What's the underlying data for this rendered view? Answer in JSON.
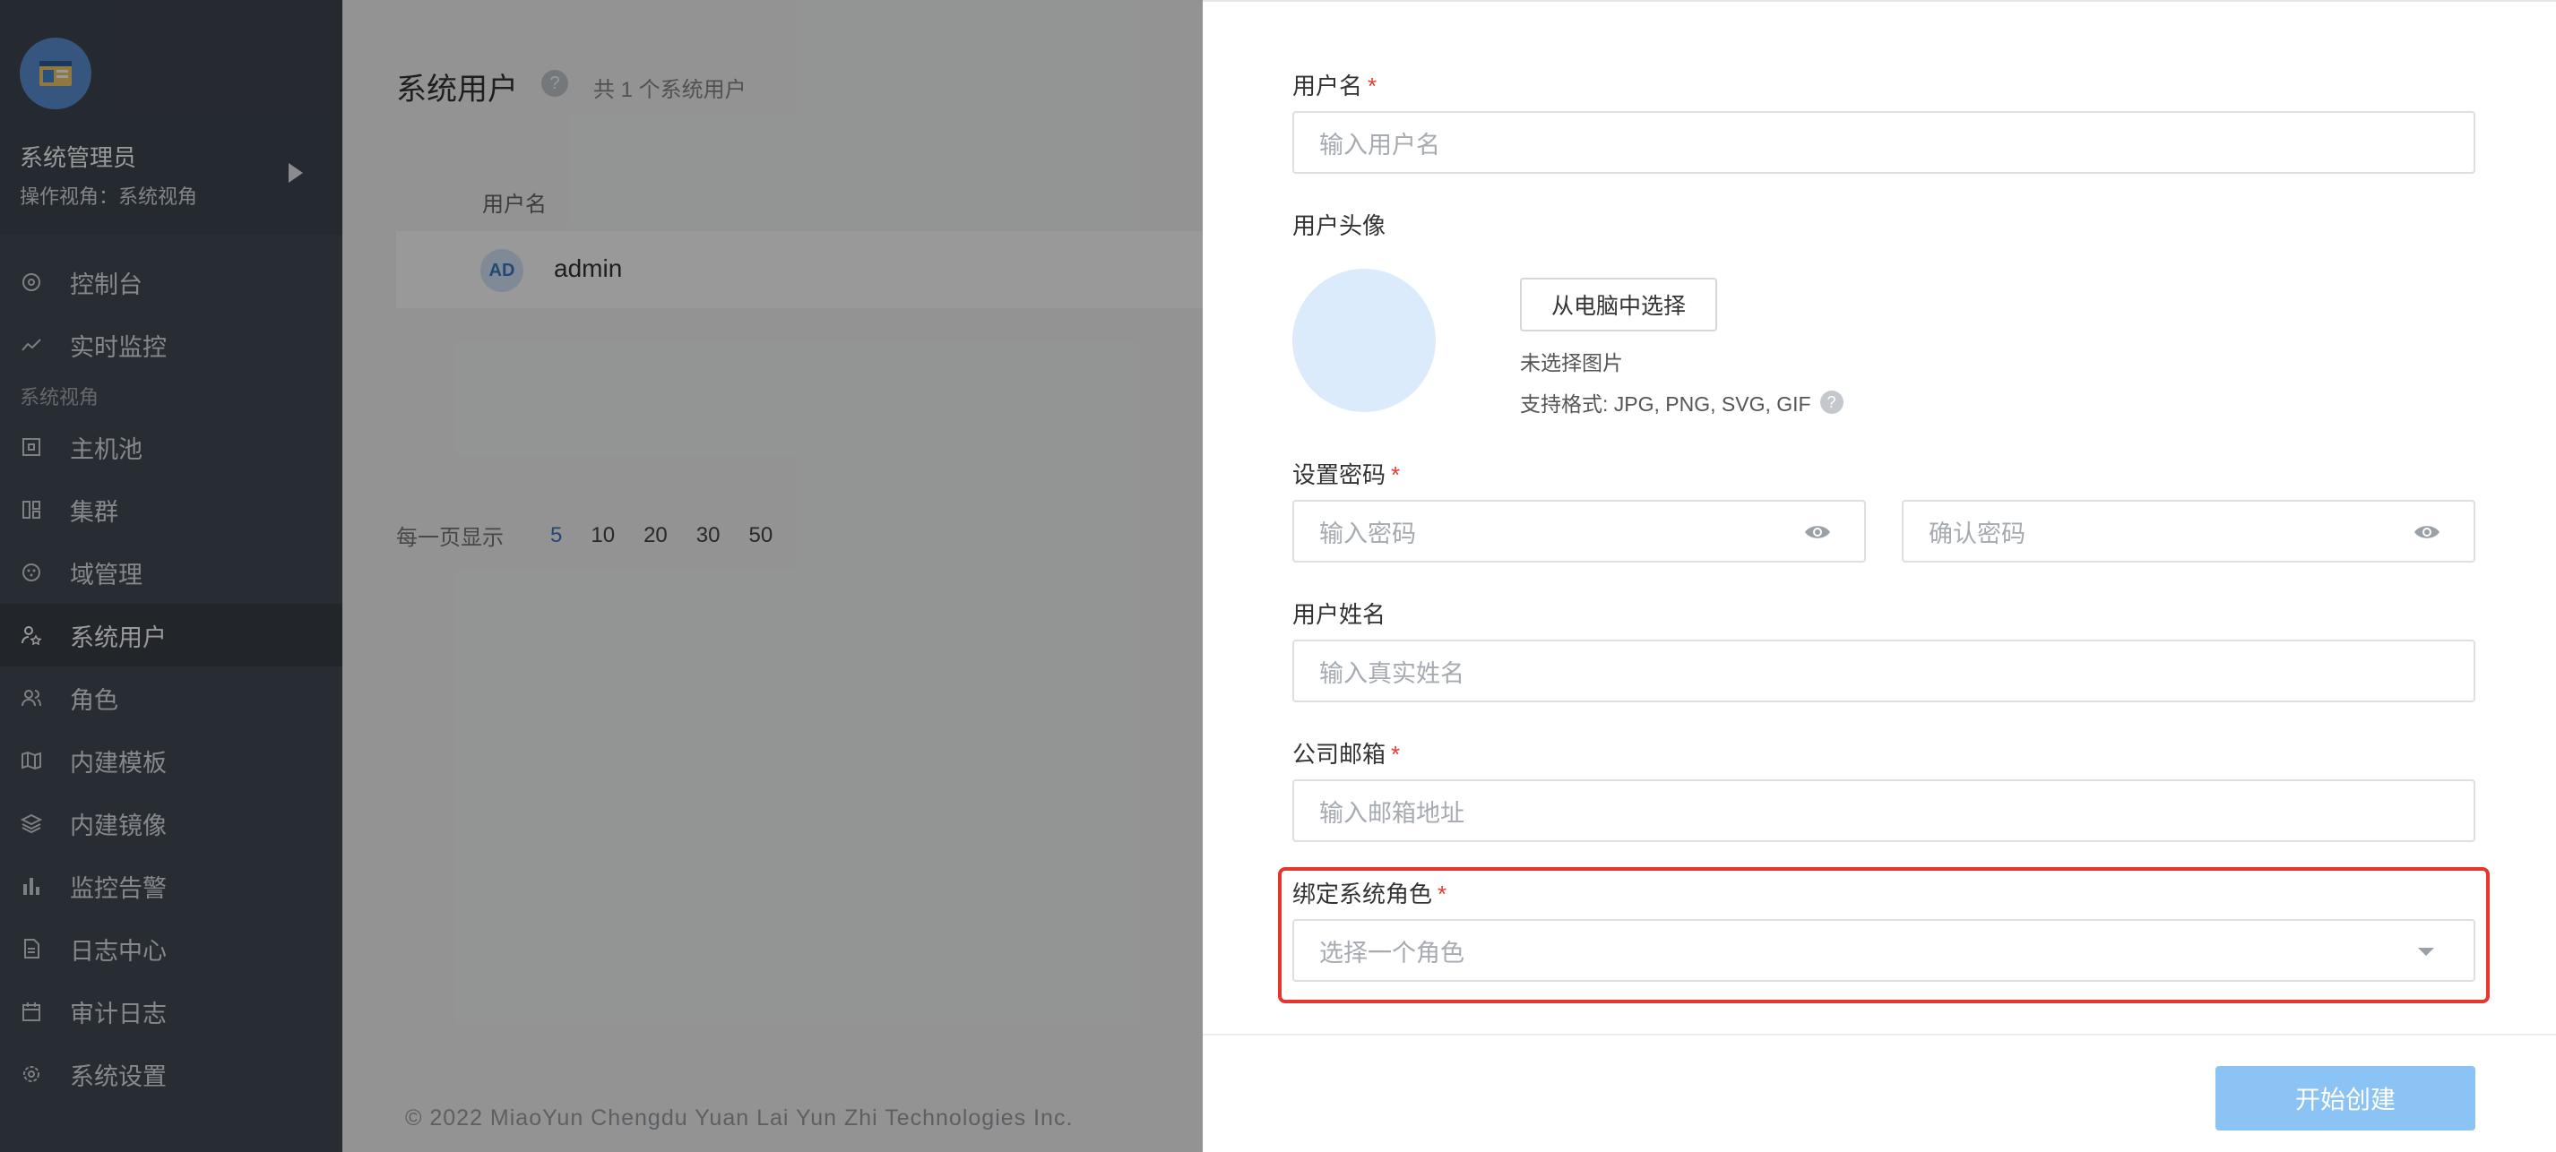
{
  "sidebar": {
    "profile": {
      "name": "系统管理员",
      "view": "操作视角：系统视角"
    },
    "items": [
      {
        "label": "控制台",
        "icon": "dashboard-icon"
      },
      {
        "label": "实时监控",
        "icon": "trend-icon"
      },
      {
        "group": "系统视角"
      },
      {
        "label": "主机池",
        "icon": "host-icon"
      },
      {
        "label": "集群",
        "icon": "cluster-icon"
      },
      {
        "label": "域管理",
        "icon": "domain-icon"
      },
      {
        "label": "系统用户",
        "icon": "user-star-icon",
        "active": true
      },
      {
        "label": "角色",
        "icon": "users-icon"
      },
      {
        "label": "内建模板",
        "icon": "template-icon"
      },
      {
        "label": "内建镜像",
        "icon": "layers-icon"
      },
      {
        "label": "监控告警",
        "icon": "bar-chart-icon"
      },
      {
        "label": "日志中心",
        "icon": "document-icon"
      },
      {
        "label": "审计日志",
        "icon": "calendar-icon"
      },
      {
        "label": "系统设置",
        "icon": "gear-icon"
      }
    ]
  },
  "main": {
    "title": "系统用户",
    "count_text": "共 1 个系统用户",
    "column_header": "用户名",
    "rows": [
      {
        "badge": "AD",
        "name": "admin"
      }
    ],
    "pagination": {
      "label": "每一页显示",
      "options": [
        "5",
        "10",
        "20",
        "30",
        "50"
      ],
      "selected": "5"
    },
    "copyright": "© 2022 MiaoYun Chengdu Yuan Lai Yun Zhi Technologies Inc."
  },
  "drawer": {
    "username": {
      "label": "用户名",
      "placeholder": "输入用户名"
    },
    "avatar": {
      "label": "用户头像",
      "choose_button": "从电脑中选择",
      "no_image": "未选择图片",
      "formats": "支持格式: JPG, PNG, SVG, GIF"
    },
    "password": {
      "label": "设置密码",
      "placeholder": "输入密码",
      "confirm_placeholder": "确认密码"
    },
    "realname": {
      "label": "用户姓名",
      "placeholder": "输入真实姓名"
    },
    "email": {
      "label": "公司邮箱",
      "placeholder": "输入邮箱地址"
    },
    "role": {
      "label": "绑定系统角色",
      "placeholder": "选择一个角色"
    },
    "submit_label": "开始创建",
    "required_mark": "*"
  },
  "colors": {
    "accent": "#3b78c2",
    "submit": "#8cc3f5",
    "highlight": "#e8342a",
    "sidebar": "#434a55"
  }
}
